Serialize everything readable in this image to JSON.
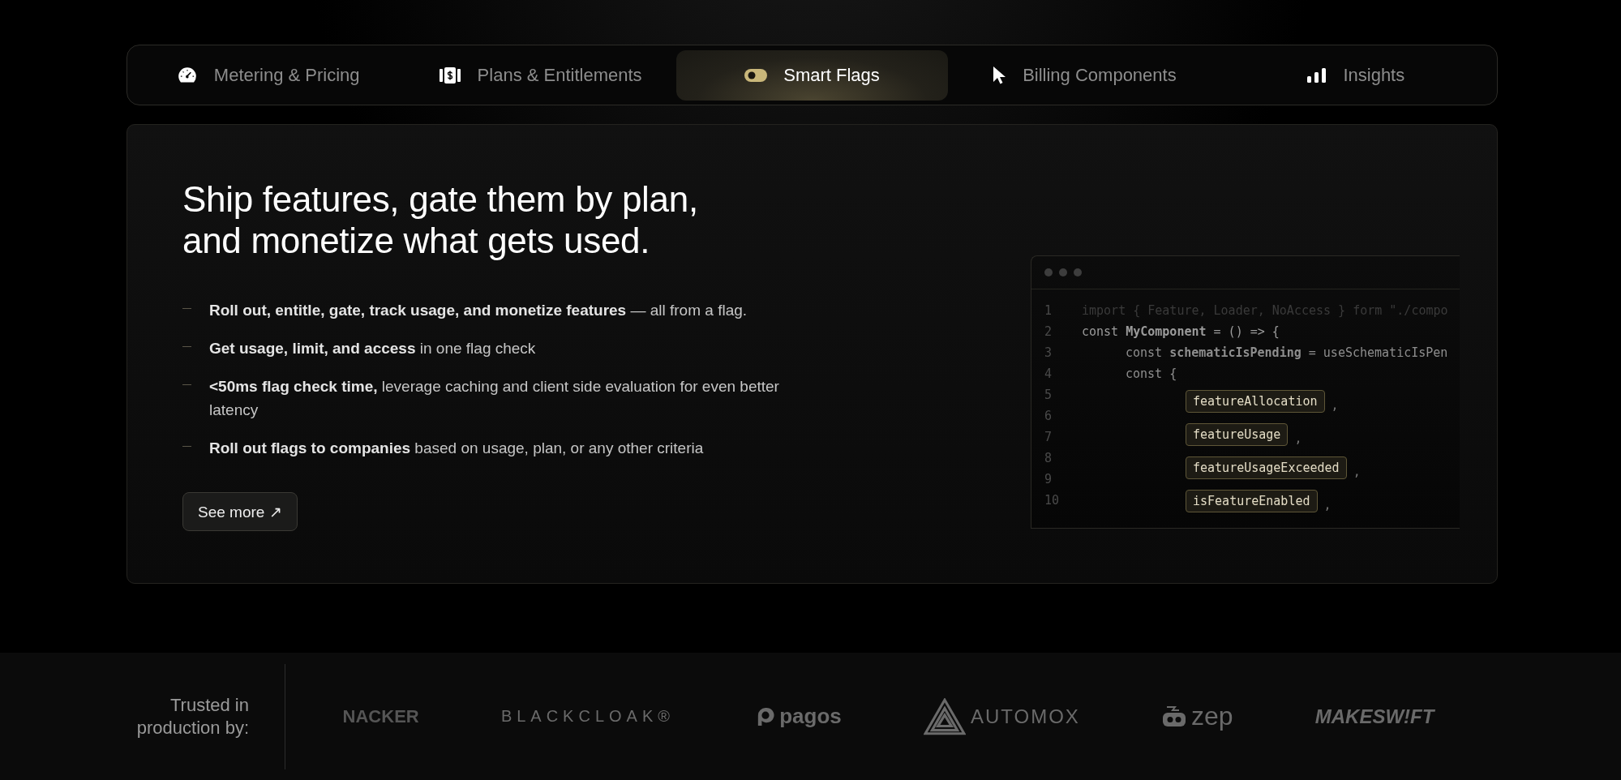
{
  "tabs": [
    {
      "label": "Metering & Pricing",
      "kind": "gauge",
      "selected": false
    },
    {
      "label": "Plans & Entitlements",
      "kind": "bill",
      "selected": false
    },
    {
      "label": "Smart Flags",
      "kind": "toggle",
      "selected": true
    },
    {
      "label": "Billing Components",
      "kind": "cursor",
      "selected": false
    },
    {
      "label": "Insights",
      "kind": "bars",
      "selected": false
    }
  ],
  "feature": {
    "heading_lines": [
      "Ship features, gate them by plan,",
      "and monetize what gets used."
    ],
    "bullets": [
      "**Roll out, entitle, gate, track usage, and monetize features** — all from a flag.",
      "**Get usage, limit, and access** in one flag check",
      "**<50ms flag check time,** leverage caching and client side evaluation for even better latency",
      "**Roll out flags to companies** based on usage, plan, or any other criteria"
    ],
    "button": "See more ↗"
  },
  "code": {
    "line_numbers": [
      "1",
      "2",
      "3",
      "4",
      "5",
      "6",
      "7",
      "8",
      "9",
      "10"
    ],
    "rows": [
      {
        "kind": "faded",
        "text": "import { Feature, Loader, NoAccess } form \"./compo"
      },
      {
        "kind": "top",
        "text": "const **MyComponent** = () => {"
      },
      {
        "kind": "inner",
        "text": "const **schematicIsPending** = useSchematicIsPen"
      },
      {
        "kind": "inner",
        "text": "const {"
      },
      {
        "kind": "tag",
        "text": "featureAllocation",
        "suffix": ","
      },
      {
        "kind": "tag",
        "text": "featureUsage",
        "suffix": ","
      },
      {
        "kind": "tag",
        "text": "featureUsageExceeded",
        "suffix": ","
      },
      {
        "kind": "tag",
        "text": "isFeatureEnabled",
        "suffix": ","
      }
    ]
  },
  "trust": {
    "label_lines": [
      "Trusted in",
      "production by:"
    ],
    "logos": [
      {
        "text": "NACKER",
        "kind": "bold"
      },
      {
        "text": "BLACKCLOAK®",
        "kind": "spaced"
      },
      {
        "text": "pagos",
        "kind": "pagos"
      },
      {
        "text": "AUTOMOX",
        "kind": "automox"
      },
      {
        "text": "zep",
        "kind": "zep"
      },
      {
        "text": "MAKESW!FT",
        "kind": "italic"
      }
    ]
  }
}
